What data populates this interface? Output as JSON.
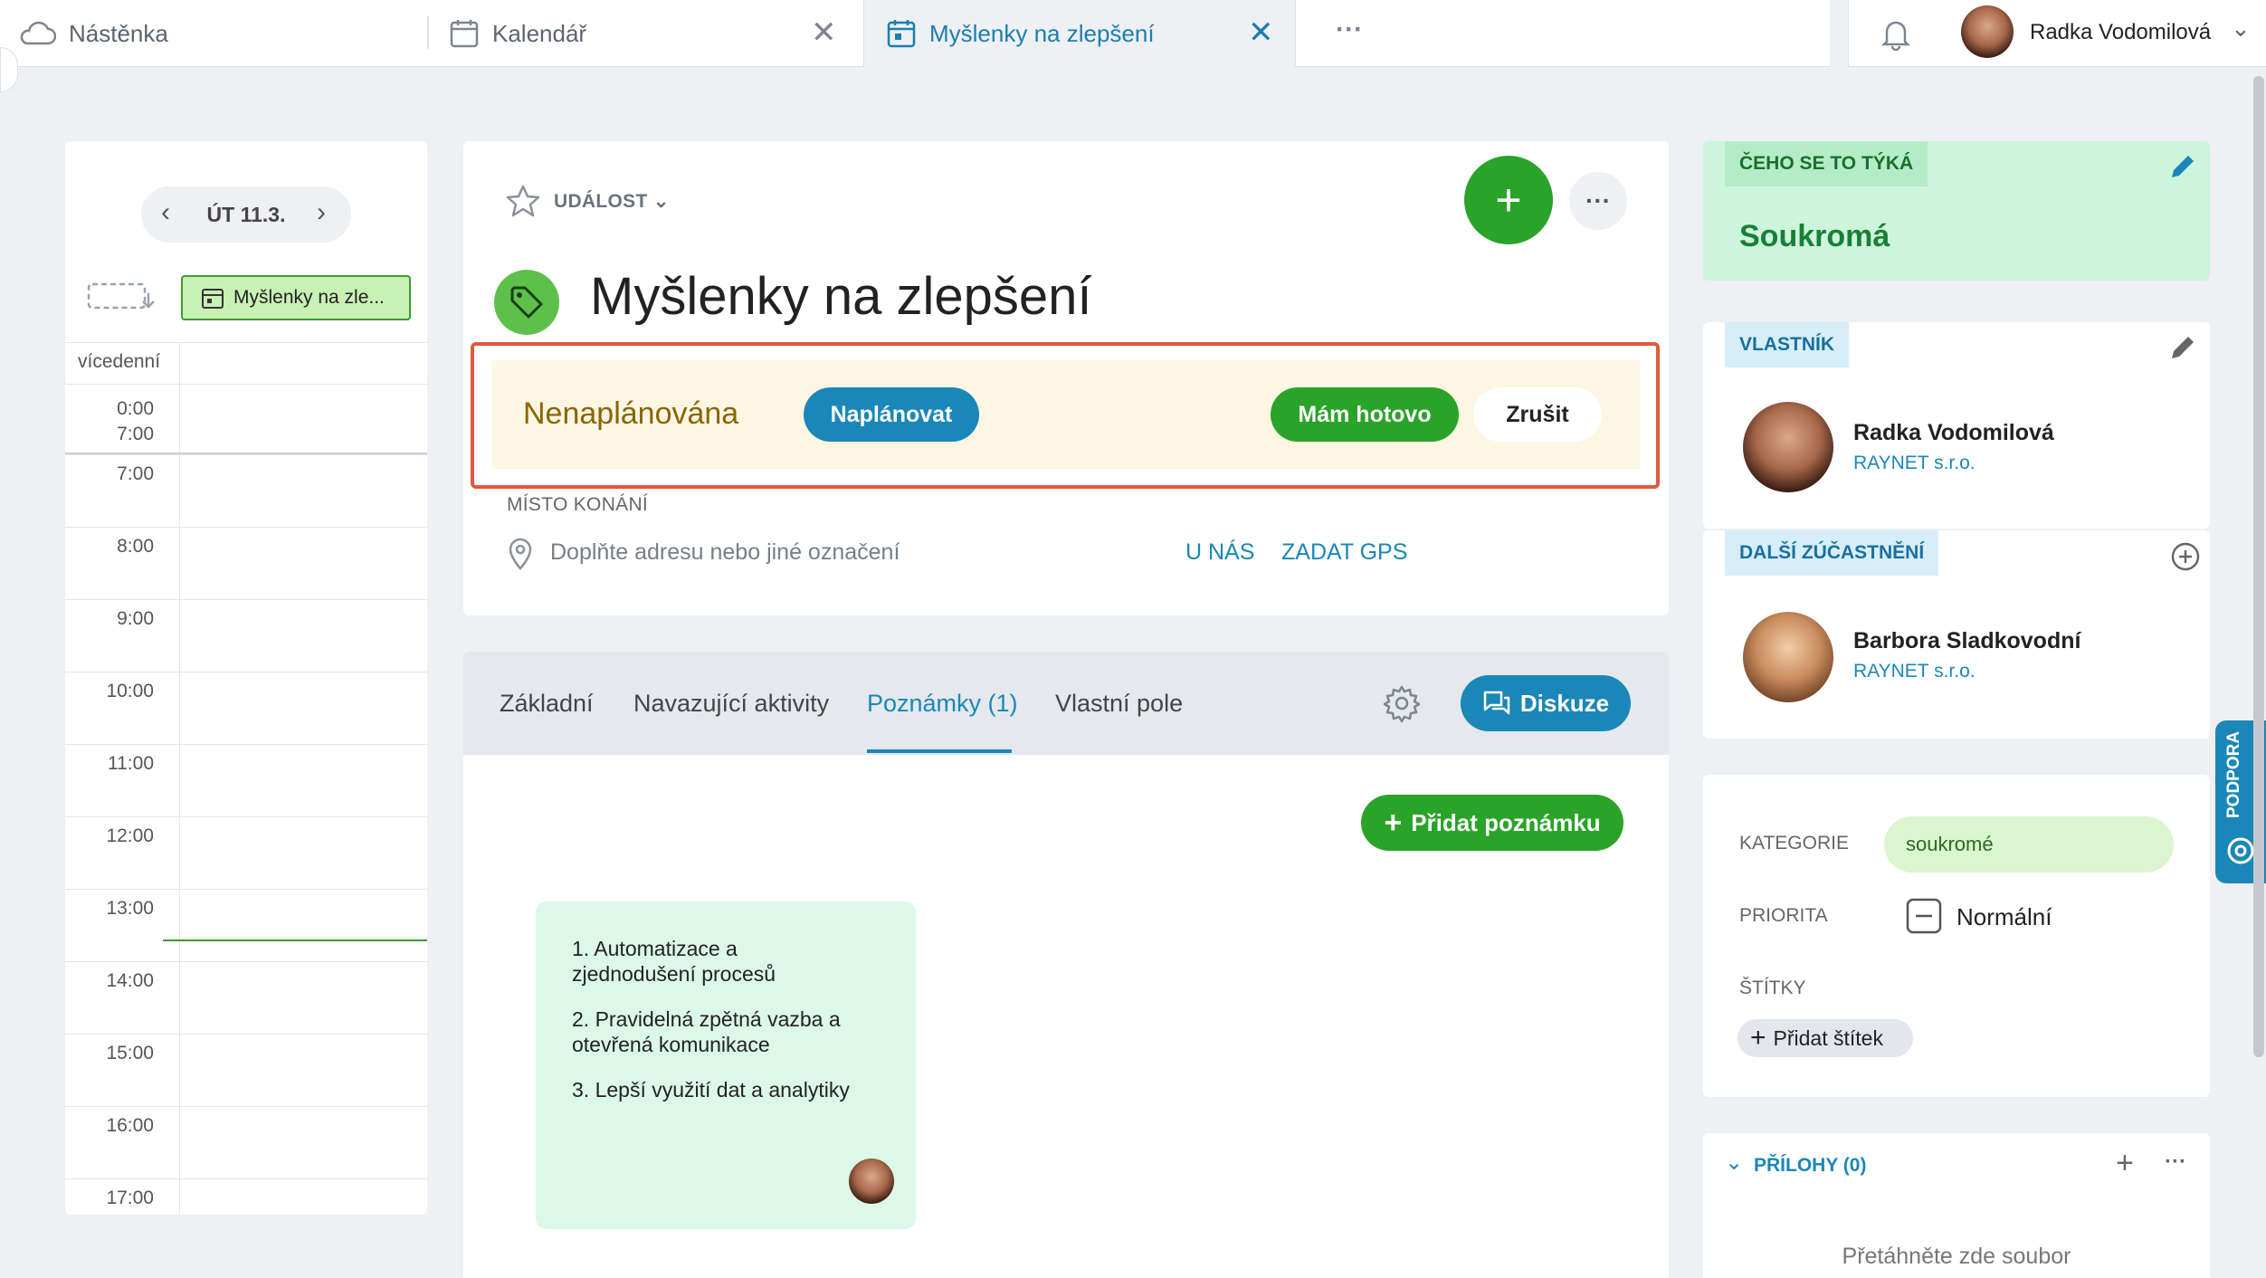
{
  "tabs": [
    {
      "label": "Nástěnka",
      "icon": "cloud-icon"
    },
    {
      "label": "Kalendář",
      "icon": "calendar-icon"
    },
    {
      "label": "Myšlenky na zlepšení",
      "icon": "calendar-icon"
    }
  ],
  "tabs_more": "···",
  "user": {
    "name": "Radka Vodomilová"
  },
  "calendar": {
    "date": "ÚT 11.3.",
    "event_chip": "Myšlenky na zle...",
    "multiday_label": "vícedenní",
    "allday_times": [
      "0:00",
      "7:00"
    ],
    "hours": [
      "7:00",
      "8:00",
      "9:00",
      "10:00",
      "11:00",
      "12:00",
      "13:00",
      "14:00",
      "15:00",
      "16:00",
      "17:00"
    ]
  },
  "event": {
    "type_label": "UDÁLOST",
    "title": "Myšlenky na zlepšení",
    "status": "Nenaplánována",
    "schedule_button": "Naplánovat",
    "done_button": "Mám hotovo",
    "cancel_button": "Zrušit",
    "location_label": "MÍSTO KONÁNÍ",
    "location_placeholder": "Doplňte adresu nebo jiné označení",
    "location_here": "U NÁS",
    "location_gps": "ZADAT GPS"
  },
  "detail_tabs": [
    "Základní",
    "Navazující aktivity",
    "Poznámky (1)",
    "Vlastní pole"
  ],
  "discussion_button": "Diskuze",
  "add_note_button": "Přidat poznámku",
  "note": {
    "lines": [
      "1. Automatizace a",
      "zjednodušení procesů",
      "2. Pravidelná zpětná vazba a",
      "otevřená komunikace",
      "3. Lepší využití dat a analytiky"
    ]
  },
  "sidebar": {
    "concerns_label": "ČEHO SE TO TÝKÁ",
    "concerns_value": "Soukromá",
    "owner_label": "VLASTNÍK",
    "owner_name": "Radka Vodomilová",
    "owner_company": "RAYNET s.r.o.",
    "participants_label": "DALŠÍ ZÚČASTNĚNÍ",
    "participant_name": "Barbora Sladkovodní",
    "participant_company": "RAYNET s.r.o.",
    "category_label": "KATEGORIE",
    "category_value": "soukromé",
    "priority_label": "PRIORITA",
    "priority_value": "Normální",
    "tags_label": "ŠTÍTKY",
    "add_tag_button": "Přidat štítek",
    "attachments_label": "PŘÍLOHY (0)",
    "drop_text": "Přetáhněte zde soubor"
  },
  "support_label": "PODPORA",
  "colors": {
    "accent_blue": "#1a87b8",
    "green": "#2aa329",
    "status_bg": "#fdf6e3",
    "highlight_border": "#e2583e"
  }
}
